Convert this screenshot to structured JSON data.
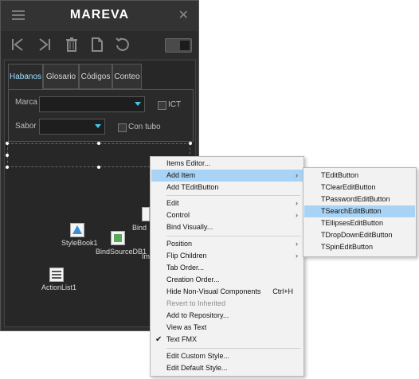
{
  "window": {
    "title": "MAREVA"
  },
  "tabs": [
    {
      "label": "Habanos"
    },
    {
      "label": "Glosario"
    },
    {
      "label": "Códigos"
    },
    {
      "label": "Conteo"
    }
  ],
  "form": {
    "marca_label": "Marca",
    "sabor_label": "Sabor",
    "ict_label": "ICT",
    "contubo_label": "Con tubo"
  },
  "components": {
    "stylebook": "StyleBook1",
    "bindsource": "BindSourceDB1",
    "actionlist": "ActionList1",
    "partial1": "Bind",
    "partial2": "Ima"
  },
  "context_menu": {
    "items": [
      {
        "label": "Items Editor..."
      },
      {
        "label": "Add Item"
      },
      {
        "label": "Add TEditButton"
      },
      {
        "label": "Edit"
      },
      {
        "label": "Control"
      },
      {
        "label": "Bind Visually..."
      },
      {
        "label": "Position"
      },
      {
        "label": "Flip Children"
      },
      {
        "label": "Tab Order..."
      },
      {
        "label": "Creation Order..."
      },
      {
        "label": "Hide Non-Visual Components",
        "shortcut": "Ctrl+H"
      },
      {
        "label": "Revert to Inherited"
      },
      {
        "label": "Add to Repository..."
      },
      {
        "label": "View as Text"
      },
      {
        "label": "Text FMX"
      },
      {
        "label": "Edit Custom Style..."
      },
      {
        "label": "Edit Default Style..."
      }
    ]
  },
  "submenu": {
    "items": [
      {
        "label": "TEditButton"
      },
      {
        "label": "TClearEditButton"
      },
      {
        "label": "TPasswordEditButton"
      },
      {
        "label": "TSearchEditButton"
      },
      {
        "label": "TEllipsesEditButton"
      },
      {
        "label": "TDropDownEditButton"
      },
      {
        "label": "TSpinEditButton"
      }
    ]
  },
  "colors": {
    "highlight": "#a9d3f4",
    "accent": "#3fc8e8"
  }
}
